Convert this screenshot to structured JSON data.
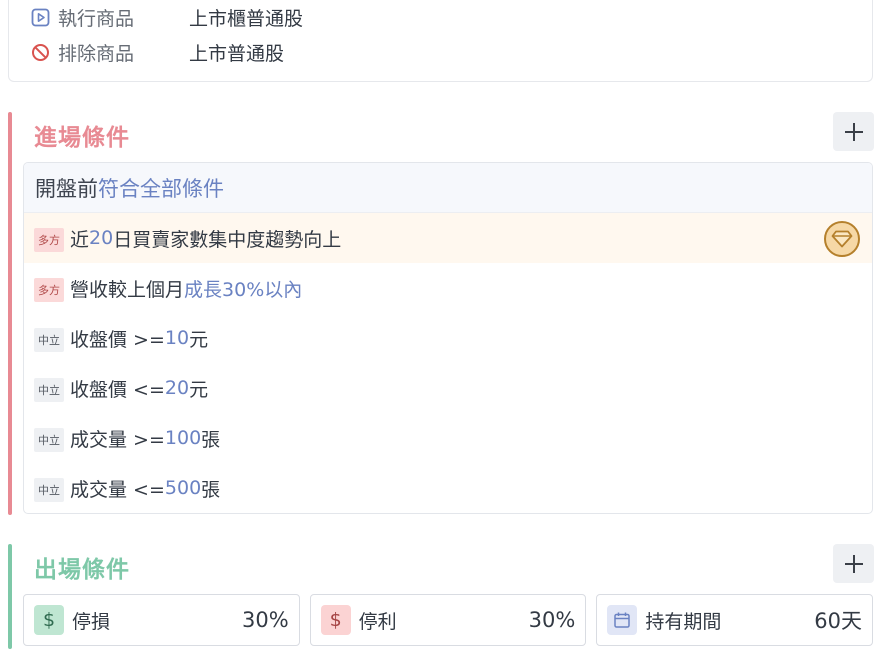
{
  "top": {
    "rows": [
      {
        "label": "執行商品",
        "value": "上市櫃普通股",
        "icon": "play-square-icon"
      },
      {
        "label": "排除商品",
        "value": "上市普通股",
        "icon": "prohibited-icon"
      }
    ]
  },
  "entry": {
    "title": "進場條件",
    "accent": "#e88a93",
    "group_prefix": "開盤前",
    "group_rule": "符合全部條件",
    "conditions": [
      {
        "tag": "多方",
        "pre": "近",
        "num": "20",
        "post": "日買賣家數集中度趨勢向上",
        "badge": "gem-icon"
      },
      {
        "tag": "多方",
        "pre": "營收較上個月",
        "num": "成長30%以內",
        "post": ""
      },
      {
        "tag": "中立",
        "pre": "收盤價 >= ",
        "num": "10",
        "post": "元"
      },
      {
        "tag": "中立",
        "pre": "收盤價 <= ",
        "num": "20",
        "post": "元"
      },
      {
        "tag": "中立",
        "pre": "成交量 >= ",
        "num": "100",
        "post": "張"
      },
      {
        "tag": "中立",
        "pre": "成交量 <= ",
        "num": "500",
        "post": "張"
      }
    ]
  },
  "exit": {
    "title": "出場條件",
    "accent": "#7ec8a8",
    "cards": [
      {
        "icon": "dollar-icon",
        "label": "停損",
        "value": "30%"
      },
      {
        "icon": "dollar-icon",
        "label": "停利",
        "value": "30%"
      },
      {
        "icon": "calendar-icon",
        "label": "持有期間",
        "value": "60天"
      }
    ]
  }
}
